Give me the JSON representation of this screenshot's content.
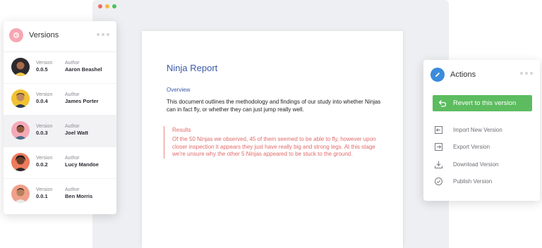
{
  "document": {
    "title": "Ninja Report",
    "overview_heading": "Overview",
    "overview_text": "This document outlines the methodology and findings of our study into whether Ninjas can in fact fly, or whether they can just jump really well.",
    "results_heading": "Results",
    "results_text": "Of the 50 Ninjas we observed, 45 of them seemed to be able to fly, however upon closer inspection it appears they just have really big and strong legs. At this stage we're unsure why the other 5 Ninjas appeared to be stuck to the ground."
  },
  "versions_panel": {
    "title": "Versions",
    "version_label": "Version",
    "author_label": "Author",
    "items": [
      {
        "version": "0.0.5",
        "author": "Aaron Beashel"
      },
      {
        "version": "0.0.4",
        "author": "James Porter"
      },
      {
        "version": "0.0.3",
        "author": "Joel Watt"
      },
      {
        "version": "0.0.2",
        "author": "Lucy Mandoe"
      },
      {
        "version": "0.0.1",
        "author": "Ben Morris"
      }
    ]
  },
  "actions_panel": {
    "title": "Actions",
    "primary_action": "Revert to this version",
    "items": [
      {
        "label": "Import New Version",
        "icon": "import-icon"
      },
      {
        "label": "Export Version",
        "icon": "export-icon"
      },
      {
        "label": "Download Version",
        "icon": "download-icon"
      },
      {
        "label": "Publish Version",
        "icon": "check-circle-icon"
      }
    ]
  },
  "colors": {
    "accent_green": "#5cbc5f",
    "doc_heading_blue": "#3b5aa6",
    "results_red": "#e26a6a",
    "versions_icon_pink": "#f6a6b3",
    "actions_icon_blue": "#3b8bdc"
  }
}
